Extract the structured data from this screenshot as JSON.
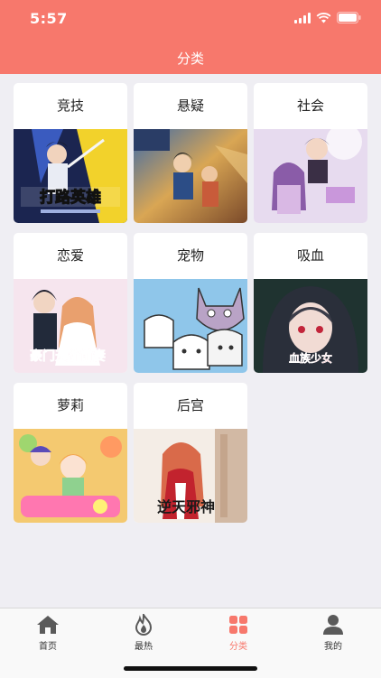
{
  "status_bar": {
    "time": "5:57"
  },
  "header": {
    "title": "分类"
  },
  "categories": [
    {
      "label": "竞技",
      "cover_text": "打路英雄"
    },
    {
      "label": "悬疑",
      "cover_text": ""
    },
    {
      "label": "社会",
      "cover_text": ""
    },
    {
      "label": "恋爱",
      "cover_text": "豪门天价前妻"
    },
    {
      "label": "宠物",
      "cover_text": ""
    },
    {
      "label": "吸血",
      "cover_text": "血族少女"
    },
    {
      "label": "萝莉",
      "cover_text": ""
    },
    {
      "label": "后宫",
      "cover_text": "逆天邪神"
    }
  ],
  "tabbar": {
    "items": [
      {
        "label": "首页",
        "icon": "home-icon"
      },
      {
        "label": "最热",
        "icon": "flame-icon"
      },
      {
        "label": "分类",
        "icon": "grid-icon",
        "active": true
      },
      {
        "label": "我的",
        "icon": "person-icon"
      }
    ]
  },
  "colors": {
    "accent": "#f7786c",
    "background": "#efeef3"
  }
}
